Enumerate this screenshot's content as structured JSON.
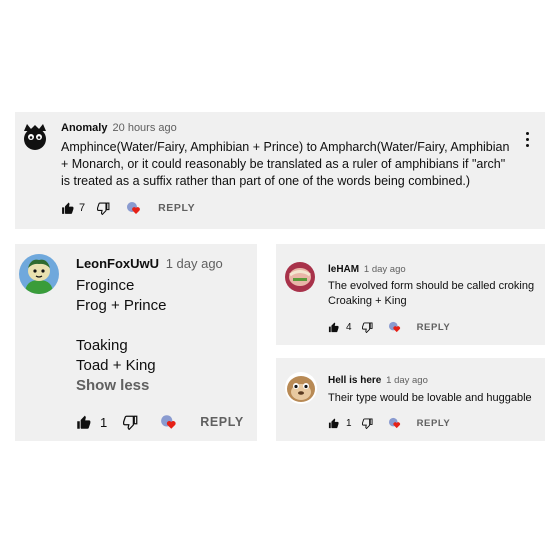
{
  "comments": {
    "top": {
      "author": "Anomaly",
      "time": "20 hours ago",
      "text": "Amphince(Water/Fairy, Amphibian + Prince) to Ampharch(Water/Fairy, Amphibian + Monarch, or it could reasonably be translated as a ruler of amphibians if \"arch\" is treated as a suffix rather than part of one of the words being combined.)",
      "likes": "7",
      "reply_label": "REPLY"
    },
    "left": {
      "author": "LeonFoxUwU",
      "time": "1 day ago",
      "lines": [
        "Frogince",
        "Frog + Prince",
        "Toaking",
        "Toad + King"
      ],
      "show_less": "Show less",
      "likes": "1",
      "reply_label": "REPLY"
    },
    "right_top": {
      "author": "leHAM",
      "time": "1 day ago",
      "text": "The evolved form should be called croking Croaking + King",
      "likes": "4",
      "reply_label": "REPLY"
    },
    "right_bottom": {
      "author": "Hell is here",
      "time": "1 day ago",
      "text": "Their type would be lovable and huggable",
      "likes": "1",
      "reply_label": "REPLY"
    }
  },
  "icons": {
    "like": "thumbs-up-icon",
    "dislike": "thumbs-down-icon",
    "creator_heart": "creator-heart-icon",
    "menu": "more-vert-icon"
  },
  "colors": {
    "card_bg": "#f0f0f0",
    "heart": "#e62117",
    "meta_gray": "#606060"
  }
}
